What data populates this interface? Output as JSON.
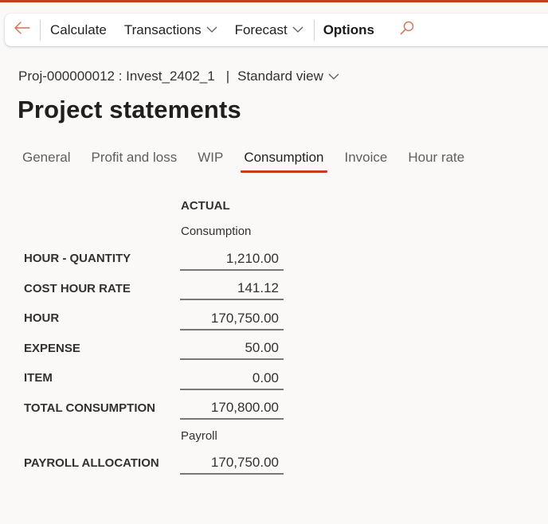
{
  "colors": {
    "accent": "#c43e1c",
    "text": "#323130",
    "background": "#faf9f8"
  },
  "action_bar": {
    "back_icon": "arrow-left-icon",
    "items": [
      {
        "label": "Calculate",
        "has_dropdown": false
      },
      {
        "label": "Transactions",
        "has_dropdown": true
      },
      {
        "label": "Forecast",
        "has_dropdown": true
      },
      {
        "label": "Options",
        "has_dropdown": false
      }
    ],
    "search_icon": "search-icon"
  },
  "breadcrumb": {
    "record": "Proj-000000012 : Invest_2402_1",
    "separator": "|",
    "view": "Standard view"
  },
  "page_title": "Project statements",
  "tabs": [
    {
      "label": "General",
      "active": false
    },
    {
      "label": "Profit and loss",
      "active": false
    },
    {
      "label": "WIP",
      "active": false
    },
    {
      "label": "Consumption",
      "active": true
    },
    {
      "label": "Invoice",
      "active": false
    },
    {
      "label": "Hour rate",
      "active": false
    }
  ],
  "statement": {
    "column_header": "ACTUAL",
    "groups": [
      {
        "title": "Consumption",
        "rows": [
          {
            "label": "HOUR - QUANTITY",
            "value": "1,210.00"
          },
          {
            "label": "COST HOUR RATE",
            "value": "141.12"
          },
          {
            "label": "HOUR",
            "value": "170,750.00"
          },
          {
            "label": "EXPENSE",
            "value": "50.00"
          },
          {
            "label": "ITEM",
            "value": "0.00"
          },
          {
            "label": "TOTAL CONSUMPTION",
            "value": "170,800.00"
          }
        ]
      },
      {
        "title": "Payroll",
        "rows": [
          {
            "label": "PAYROLL ALLOCATION",
            "value": "170,750.00"
          }
        ]
      }
    ]
  }
}
